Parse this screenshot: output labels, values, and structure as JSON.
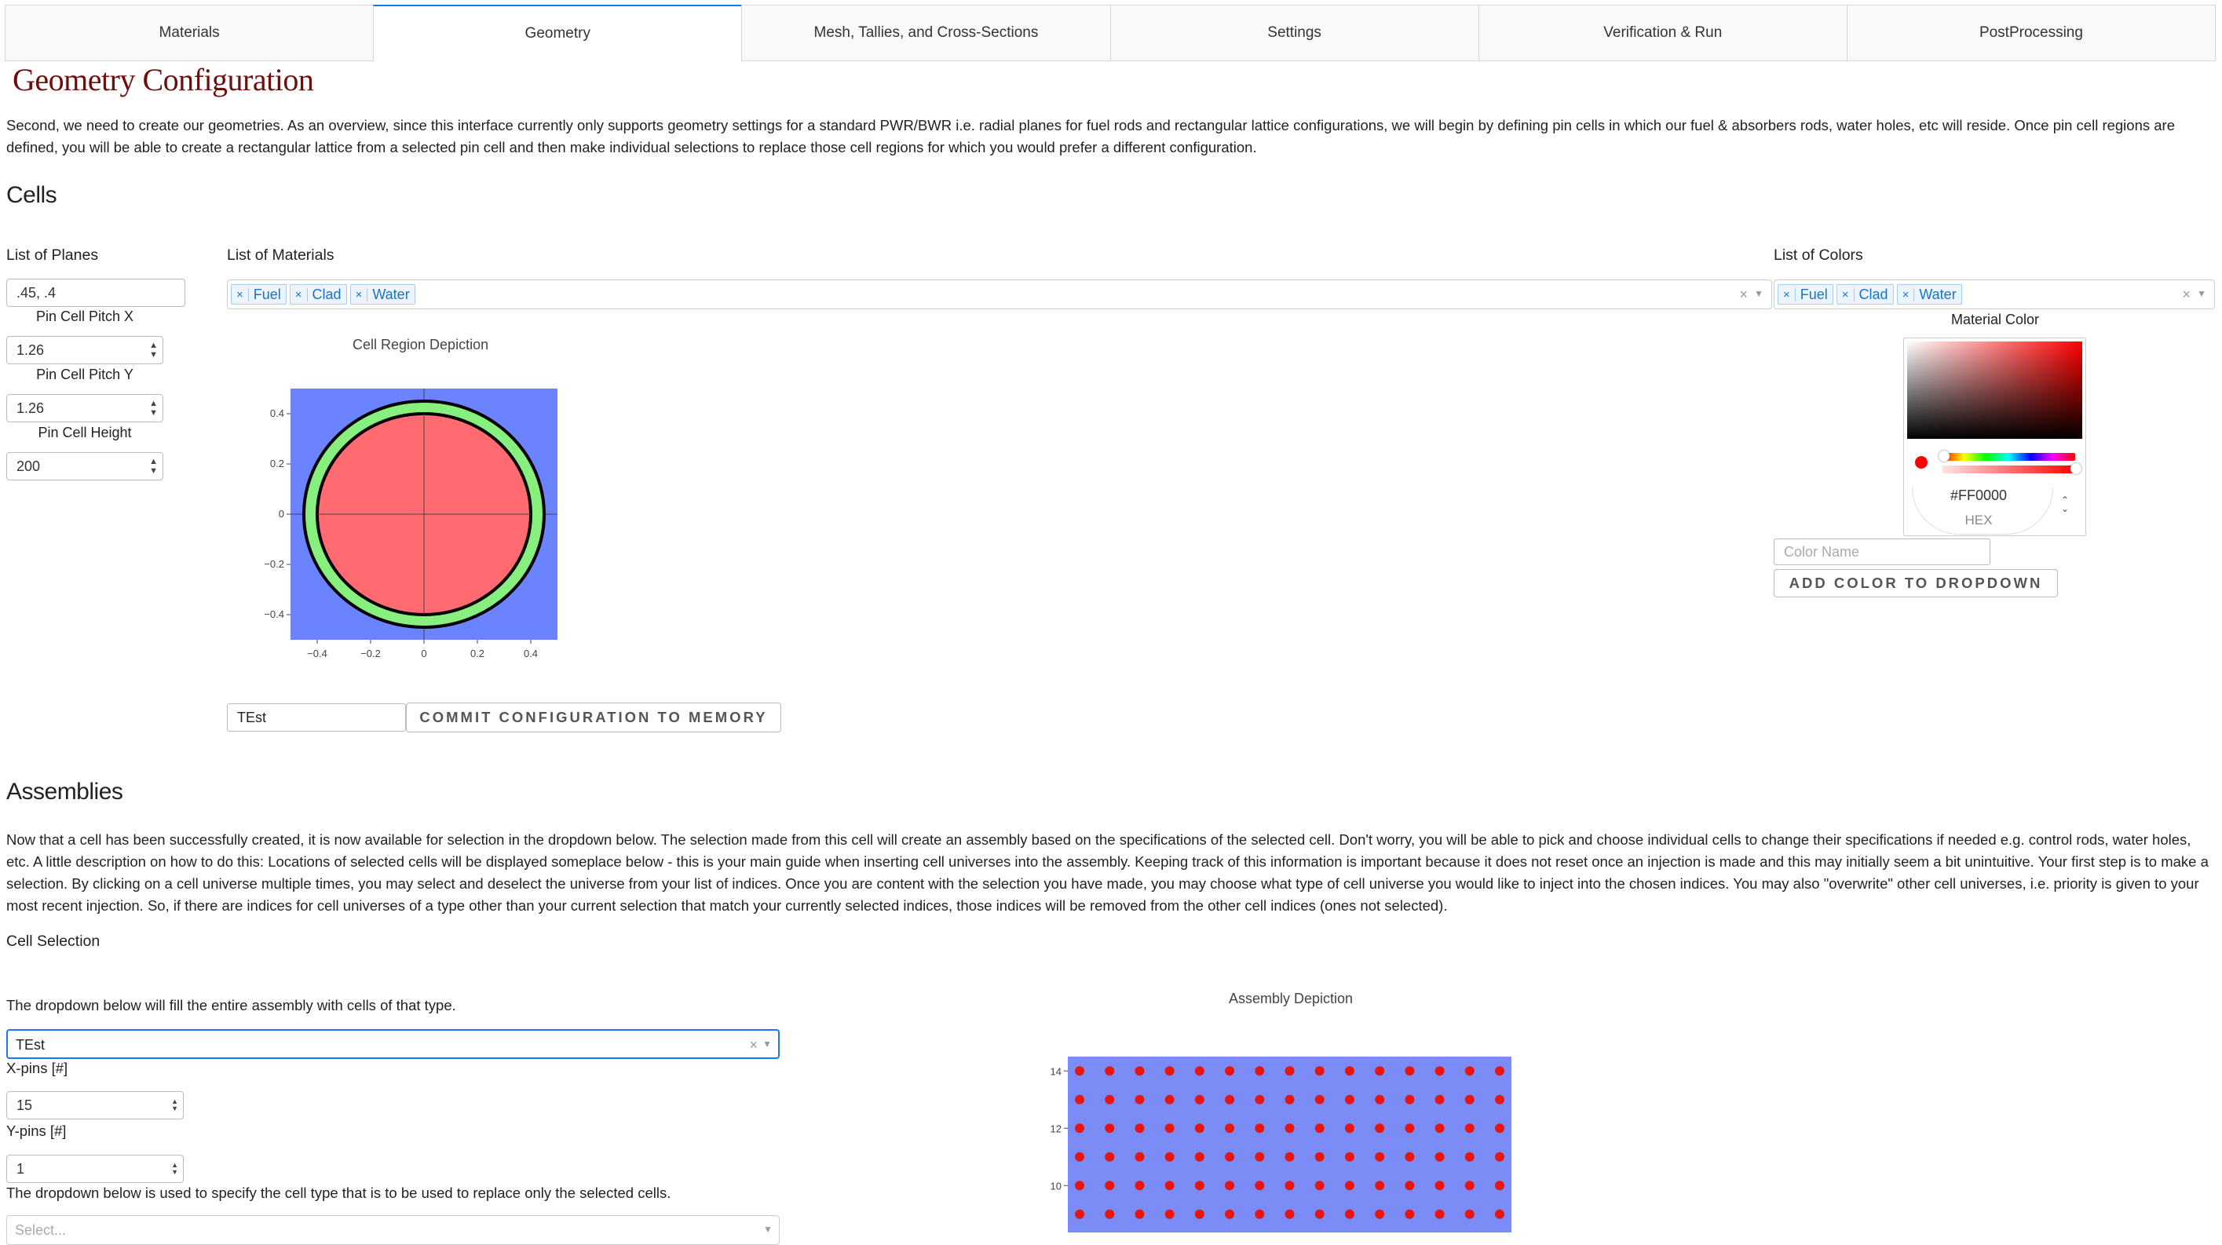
{
  "tabs": [
    {
      "label": "Materials"
    },
    {
      "label": "Geometry"
    },
    {
      "label": "Mesh, Tallies, and Cross-Sections"
    },
    {
      "label": "Settings"
    },
    {
      "label": "Verification & Run"
    },
    {
      "label": "PostProcessing"
    }
  ],
  "active_tab": "Geometry",
  "page_title": "Geometry Configuration",
  "intro": "Second, we need to create our geometries. As an overview, since this interface currently only supports geometry settings for a standard PWR/BWR i.e. radial planes for fuel rods and rectangular lattice configurations, we will begin by defining pin cells in which our fuel & absorbers rods, water holes, etc will reside. Once pin cell regions are defined, you will be able to create a rectangular lattice from a selected pin cell and then make individual selections to replace those cell regions for which you would prefer a different configuration.",
  "cells": {
    "heading": "Cells",
    "planes_label": "List of Planes",
    "planes_value": ".45, .4",
    "pitch_x_label": "Pin Cell Pitch X",
    "pitch_x_value": "1.26",
    "pitch_y_label": "Pin Cell Pitch Y",
    "pitch_y_value": "1.26",
    "height_label": "Pin Cell Height",
    "height_value": "200",
    "materials_label": "List of Materials",
    "materials": [
      "Fuel",
      "Clad",
      "Water"
    ],
    "colors_label": "List of Colors",
    "colors": [
      "Fuel",
      "Clad",
      "Water"
    ],
    "material_color_label": "Material Color",
    "color_hex": "#FF0000",
    "color_format": "HEX",
    "color_name_placeholder": "Color Name",
    "add_color_button": "ADD COLOR TO DROPDOWN",
    "config_name_value": "TEst",
    "commit_button": "COMMIT CONFIGURATION TO MEMORY",
    "depiction_title": "Cell Region Depiction",
    "depiction_colors": {
      "fuel": "#ff6b70",
      "clad": "#86ef7d",
      "water": "#6b83ff"
    }
  },
  "assemblies": {
    "heading": "Assemblies",
    "description": "Now that a cell has been successfully created, it is now available for selection in the dropdown below. The selection made from this cell will create an assembly based on the specifications of the selected cell. Don't worry, you will be able to pick and choose individual cells to change their specifications if needed e.g. control rods, water holes, etc. A little description on how to do this: Locations of selected cells will be displayed someplace below - this is your main guide when inserting cell universes into the assembly. Keeping track of this information is important because it does not reset once an injection is made and this may initially seem a bit unintuitive. Your first step is to make a selection. By clicking on a cell universe multiple times, you may select and deselect the universe from your list of indices. Once you are content with the selection you have made, you may choose what type of cell universe you would like to inject into the chosen indices. You may also \"overwrite\" other cell universes, i.e. priority is given to your most recent injection. So, if there are indices for cell universes of a type other than your current selection that match your currently selected indices, those indices will be removed from the other cell indices (ones not selected).",
    "cell_selection_label": "Cell Selection",
    "fill_note": "The dropdown below will fill the entire assembly with cells of that type.",
    "fill_value": "TEst",
    "xpins_label": "X-pins [#]",
    "xpins_value": "15",
    "ypins_label": "Y-pins [#]",
    "ypins_value": "1",
    "replace_note": "The dropdown below is used to specify the cell type that is to be used to replace only the selected cells.",
    "replace_placeholder": "Select...",
    "depiction_title": "Assembly Depiction",
    "depiction_colors": {
      "background": "#7b8cf7",
      "pin": "#e8150f"
    }
  },
  "chart_data": [
    {
      "type": "scatter",
      "title": "Cell Region Depiction",
      "description_regions": [
        {
          "name": "Fuel",
          "radius": 0.4
        },
        {
          "name": "Clad",
          "radius": 0.45
        }
      ],
      "xlim": [
        -0.5,
        0.5
      ],
      "ylim": [
        -0.5,
        0.5
      ],
      "xticks": [
        "−0.4",
        "−0.2",
        "0",
        "0.2",
        "0.4"
      ],
      "yticks": [
        "0.4",
        "0.2",
        "0",
        "−0.2",
        "−0.4"
      ]
    },
    {
      "type": "scatter",
      "title": "Assembly Depiction",
      "x_pins": 15,
      "visible_y_range": [
        8.5,
        14.5
      ],
      "yticks": [
        "14",
        "12",
        "10"
      ]
    }
  ]
}
